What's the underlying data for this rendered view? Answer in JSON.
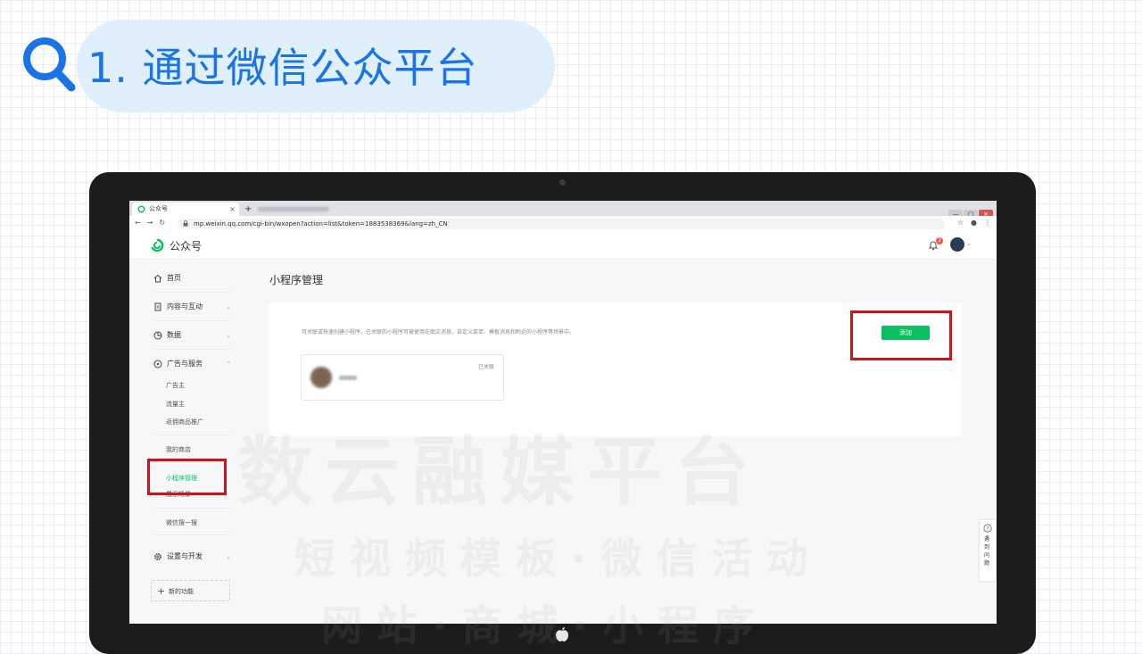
{
  "heading": {
    "title": "1. 通过微信公众平台"
  },
  "browser": {
    "tab_title": "公众号",
    "tab_close": "×",
    "new_tab": "+",
    "url": "mp.weixin.qq.com/cgi-bin/wxopen?action=list&token=1883538369&lang=zh_CN"
  },
  "app": {
    "logo_text": "公众号",
    "notification_count": "2"
  },
  "sidebar": {
    "items": [
      {
        "label": "首页",
        "icon": "home-icon"
      },
      {
        "label": "内容与互动",
        "icon": "document-icon"
      },
      {
        "label": "数据",
        "icon": "chart-icon"
      },
      {
        "label": "广告与服务",
        "icon": "compass-icon"
      },
      {
        "label": "设置与开发",
        "icon": "gear-icon"
      }
    ],
    "sub_items": [
      "广告主",
      "流量主",
      "返佣商品推广",
      "我的商店",
      "小程序管理",
      "展示场景",
      "微信搜一搜"
    ],
    "new_feature": "新的功能"
  },
  "main": {
    "page_title": "小程序管理",
    "description": "可关联或快速创建小程序，已关联的小程序可被使用在图文消息、自定义菜单、模板消息和附近的小程序等场景中。",
    "add_button": "添加",
    "linked_app_status": "已关联"
  },
  "help_widget": {
    "text": "遇到问题"
  },
  "watermark": {
    "line1": "数云融媒平台",
    "line2": "短视频模板·微信活动",
    "line3": "网站·商城·小程序"
  },
  "colors": {
    "accent_blue": "#1a74e8",
    "wechat_green": "#07c160",
    "highlight_red": "#d0121b"
  }
}
